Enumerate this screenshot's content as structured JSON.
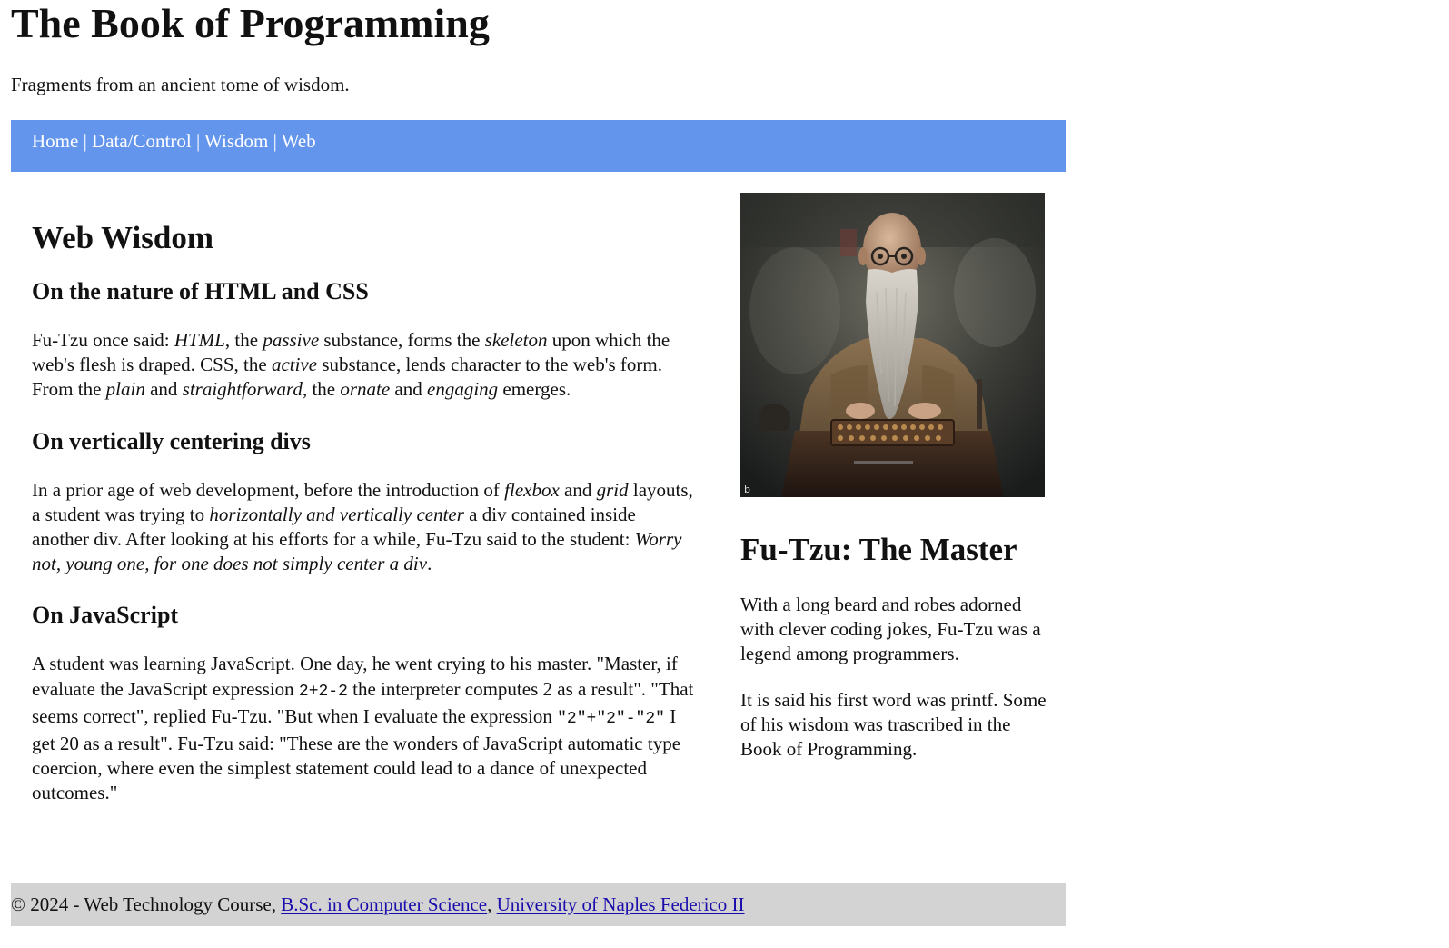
{
  "header": {
    "title": "The Book of Programming",
    "subtitle": "Fragments from an ancient tome of wisdom."
  },
  "nav": {
    "items": [
      {
        "label": "Home"
      },
      {
        "label": "Data/Control"
      },
      {
        "label": "Wisdom"
      },
      {
        "label": "Web"
      }
    ],
    "separator": " | "
  },
  "main": {
    "title": "Web Wisdom",
    "sections": [
      {
        "heading": "On the nature of HTML and CSS",
        "p1": "Fu-Tzu once said: ",
        "e1": "HTML",
        "p2": ", the ",
        "e2": "passive",
        "p3": " substance, forms the ",
        "e3": "skeleton",
        "p4": " upon which the web's flesh is draped. CSS, the ",
        "e4": "active",
        "p5": " substance, lends character to the web's form. From the ",
        "e5": "plain",
        "p6": " and ",
        "e6": "straightforward",
        "p7": ", the ",
        "e7": "ornate",
        "p8": " and ",
        "e8": "engaging",
        "p9": " emerges."
      },
      {
        "heading": "On vertically centering divs",
        "p1": "In a prior age of web development, before the introduction of ",
        "e1": "flexbox",
        "p2": " and ",
        "e2": "grid",
        "p3": " layouts, a student was trying to ",
        "e3": "horizontally and vertically center",
        "p4": " a div contained inside another div. After looking at his efforts for a while, Fu-Tzu said to the student: ",
        "e4": "Worry not, young one, for one does not simply center a div",
        "p5": "."
      },
      {
        "heading": "On JavaScript",
        "p1": "A student was learning JavaScript. One day, he went crying to his master. \"Master, if evaluate the JavaScript expression ",
        "c1": "2+2-2",
        "p2": " the interpreter computes 2 as a result\". \"That seems correct\", replied Fu-Tzu. \"But when I evaluate the expression ",
        "c2": "\"2\"+\"2\"-\"2\"",
        "p3": " I get 20 as a result\". Fu-Tzu said: \"These are the wonders of JavaScript automatic type coercion, where even the simplest statement could lead to a dance of unexpected outcomes.\""
      }
    ]
  },
  "aside": {
    "image_alt": "Portrait of Fu-Tzu, an old bearded master at an abacus",
    "image_mark": "b",
    "title": "Fu-Tzu: The Master",
    "paragraphs": [
      "With a long beard and robes adorned with clever coding jokes, Fu-Tzu was a legend among programmers.",
      "It is said his first word was printf. Some of his wisdom was trascribed in the Book of Programming."
    ]
  },
  "footer": {
    "prefix": "© 2024 - Web Technology Course, ",
    "link1": "B.Sc. in Computer Science",
    "sep": ", ",
    "link2": "University of Naples Federico II"
  },
  "colors": {
    "nav_bg": "#6495ED",
    "footer_bg": "#d3d3d3",
    "link": "#1a0dab"
  }
}
